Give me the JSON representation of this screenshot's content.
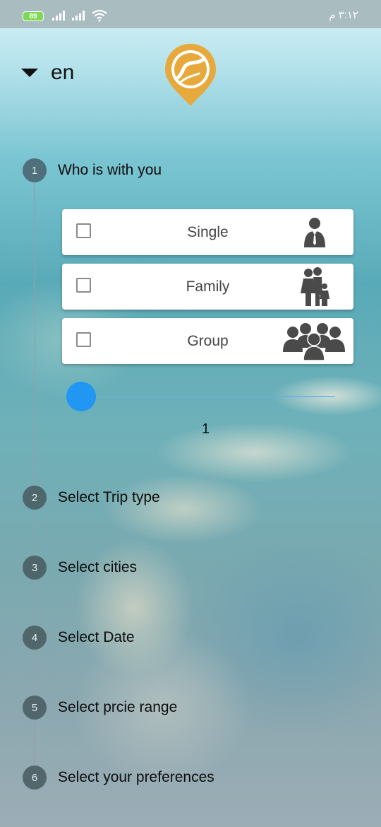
{
  "status_bar": {
    "battery": "89",
    "time": "٣:١٢ م"
  },
  "header": {
    "language": "en",
    "logo_color": "#e8a93c"
  },
  "steps": [
    {
      "number": "1",
      "label": "Who is with you"
    },
    {
      "number": "2",
      "label": "Select Trip type"
    },
    {
      "number": "3",
      "label": "Select cities"
    },
    {
      "number": "4",
      "label": "Select Date"
    },
    {
      "number": "5",
      "label": "Select prcie range"
    },
    {
      "number": "6",
      "label": "Select your preferences"
    }
  ],
  "companion_options": [
    {
      "label": "Single",
      "checked": false,
      "icon": "single-person-icon"
    },
    {
      "label": "Family",
      "checked": false,
      "icon": "family-icon"
    },
    {
      "label": "Group",
      "checked": false,
      "icon": "group-icon"
    }
  ],
  "companions_slider": {
    "value": "1",
    "accent": "#2196f3"
  }
}
